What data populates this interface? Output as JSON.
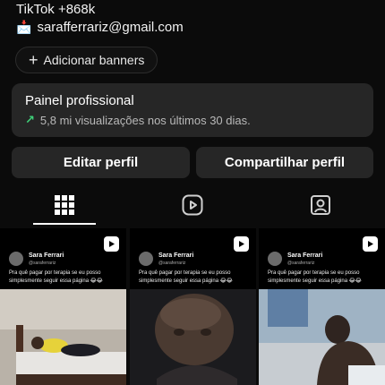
{
  "profile": {
    "tiktok_line": "TikTok +868k",
    "email": "sarafferrariz@gmail.com",
    "banner_button": "Adicionar banners"
  },
  "pro_panel": {
    "title": "Painel profissional",
    "stats": "5,8 mi visualizações nos últimos 30 dias."
  },
  "actions": {
    "edit": "Editar perfil",
    "share": "Compartilhar perfil"
  },
  "tabs": [
    {
      "name": "grid",
      "icon": "grid-icon",
      "active": true
    },
    {
      "name": "reels",
      "icon": "reels-icon",
      "active": false
    },
    {
      "name": "tagged",
      "icon": "tagged-icon",
      "active": false
    }
  ],
  "posts": [
    {
      "author": "Sara Ferrari",
      "handle": "@saraferrariz",
      "caption": "Pra quê pagar por terapia se eu posso simplesmente seguir essa página 😂😂"
    },
    {
      "author": "Sara Ferrari",
      "handle": "@saraferrariz",
      "caption": "Pra quê pagar por terapia se eu posso simplesmente seguir essa página 😂😂"
    },
    {
      "author": "Sara Ferrari",
      "handle": "@saraferrariz",
      "caption": "Pra quê pagar por terapia se eu posso simplesmente seguir essa página 😂😂"
    }
  ],
  "colors": {
    "background": "#0b0b0b",
    "panel": "#262626",
    "growth_arrow": "#3fd27a"
  }
}
